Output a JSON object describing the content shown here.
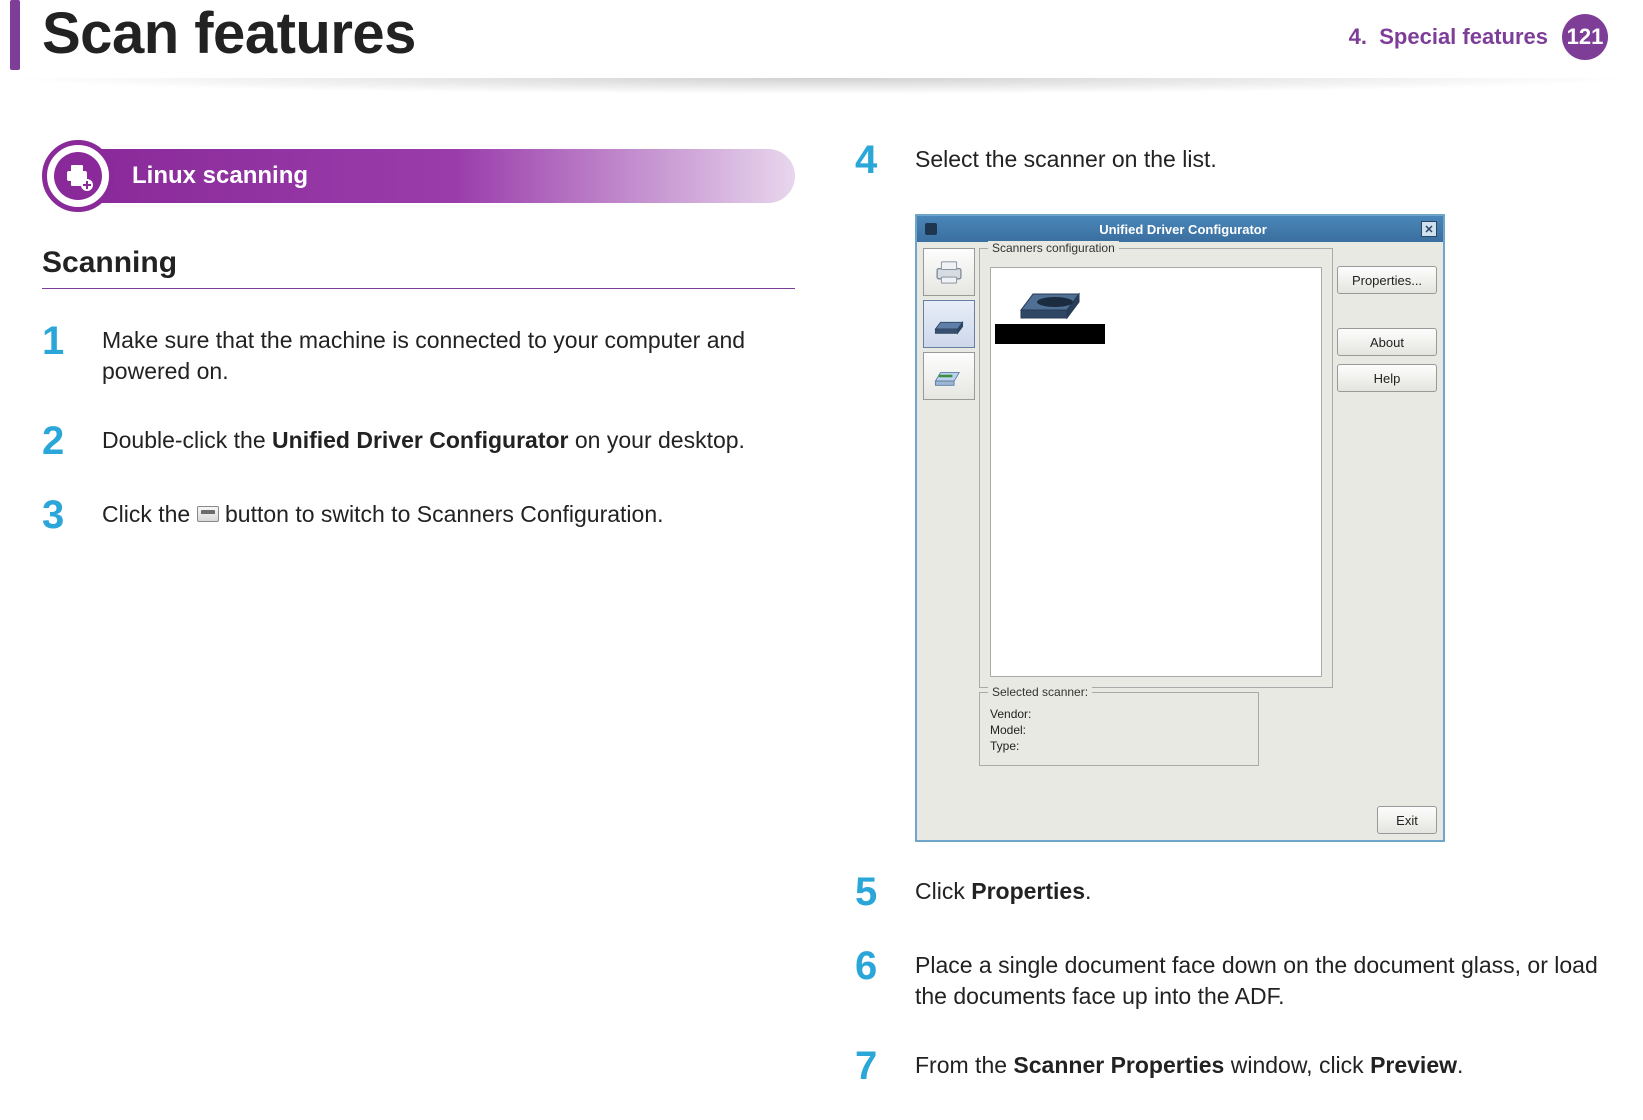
{
  "header": {
    "title": "Scan features",
    "chapter_prefix": "4.",
    "chapter_name": "Special features",
    "page_number": "121"
  },
  "section": {
    "pill_label": "Linux scanning",
    "subheading": "Scanning"
  },
  "steps_left": [
    {
      "num": "1",
      "parts": [
        {
          "t": "Make sure that the machine is connected to your computer and powered on."
        }
      ]
    },
    {
      "num": "2",
      "parts": [
        {
          "t": "Double-click the "
        },
        {
          "t": "Unified Driver Configurator",
          "b": true
        },
        {
          "t": " on your desktop."
        }
      ]
    },
    {
      "num": "3",
      "parts": [
        {
          "t": "Click the "
        },
        {
          "icon": "scanner-inline-icon"
        },
        {
          "t": " button to switch to Scanners Configuration."
        }
      ]
    }
  ],
  "steps_right_top": {
    "num": "4",
    "parts": [
      {
        "t": "Select the scanner on the list."
      }
    ]
  },
  "steps_right_bottom": [
    {
      "num": "5",
      "parts": [
        {
          "t": "Click "
        },
        {
          "t": "Properties",
          "b": true
        },
        {
          "t": "."
        }
      ]
    },
    {
      "num": "6",
      "parts": [
        {
          "t": "Place a single document face down on the document glass, or load the documents face up into the ADF."
        }
      ]
    },
    {
      "num": "7",
      "parts": [
        {
          "t": "From the "
        },
        {
          "t": "Scanner Properties",
          "b": true
        },
        {
          "t": " window, click "
        },
        {
          "t": "Preview",
          "b": true
        },
        {
          "t": "."
        }
      ]
    }
  ],
  "screenshot": {
    "window_title": "Unified Driver Configurator",
    "fieldset_scanners": "Scanners configuration",
    "fieldset_selected": "Selected scanner:",
    "selected_rows": {
      "vendor": "Vendor:",
      "model": "Model:",
      "type": "Type:"
    },
    "buttons": {
      "properties": "Properties...",
      "about": "About",
      "help": "Help",
      "exit": "Exit"
    }
  }
}
